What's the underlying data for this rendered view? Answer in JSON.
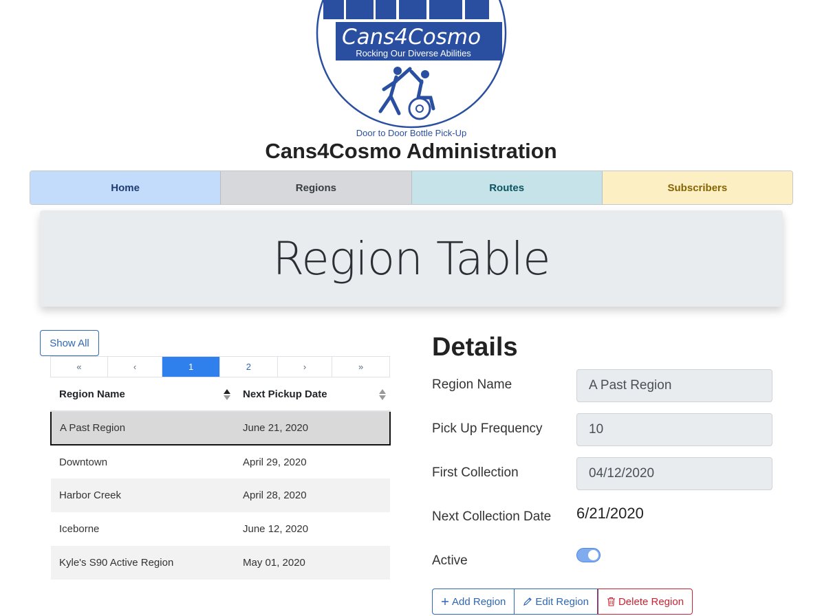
{
  "logo": {
    "name": "Cans4Cosmo",
    "tagline": "Rocking Our Diverse Abilities",
    "subtitle": "Door to Door Bottle Pick-Up"
  },
  "header": {
    "title": "Cans4Cosmo Administration"
  },
  "nav": {
    "items": [
      {
        "label": "Home"
      },
      {
        "label": "Regions"
      },
      {
        "label": "Routes"
      },
      {
        "label": "Subscribers"
      }
    ]
  },
  "jumbotron": {
    "title": "Region Table"
  },
  "table": {
    "show_all_label": "Show All",
    "pagination": {
      "first": "«",
      "prev": "‹",
      "pages": [
        "1",
        "2"
      ],
      "active_page": "1",
      "next": "›",
      "last": "»"
    },
    "columns": [
      "Region Name",
      "Next Pickup Date"
    ],
    "rows": [
      {
        "name": "A Past Region",
        "date": "June 21, 2020"
      },
      {
        "name": "Downtown",
        "date": "April 29, 2020"
      },
      {
        "name": "Harbor Creek",
        "date": "April 28, 2020"
      },
      {
        "name": "Iceborne",
        "date": "June 12, 2020"
      },
      {
        "name": "Kyle's S90 Active Region",
        "date": "May 01, 2020"
      }
    ]
  },
  "details": {
    "title": "Details",
    "region_name_label": "Region Name",
    "region_name_value": "A Past Region",
    "frequency_label": "Pick Up Frequency",
    "frequency_value": "10",
    "first_collection_label": "First Collection",
    "first_collection_value": "04/12/2020",
    "next_collection_label": "Next Collection Date",
    "next_collection_value": "6/21/2020",
    "active_label": "Active",
    "active_value": true
  },
  "actions": {
    "add_label": "Add Region",
    "edit_label": "Edit Region",
    "delete_label": "Delete Region"
  },
  "colors": {
    "brand_blue": "#2a4fa0",
    "primary": "#2f67b3",
    "danger": "#c82333",
    "active_page": "#2f80ed"
  }
}
